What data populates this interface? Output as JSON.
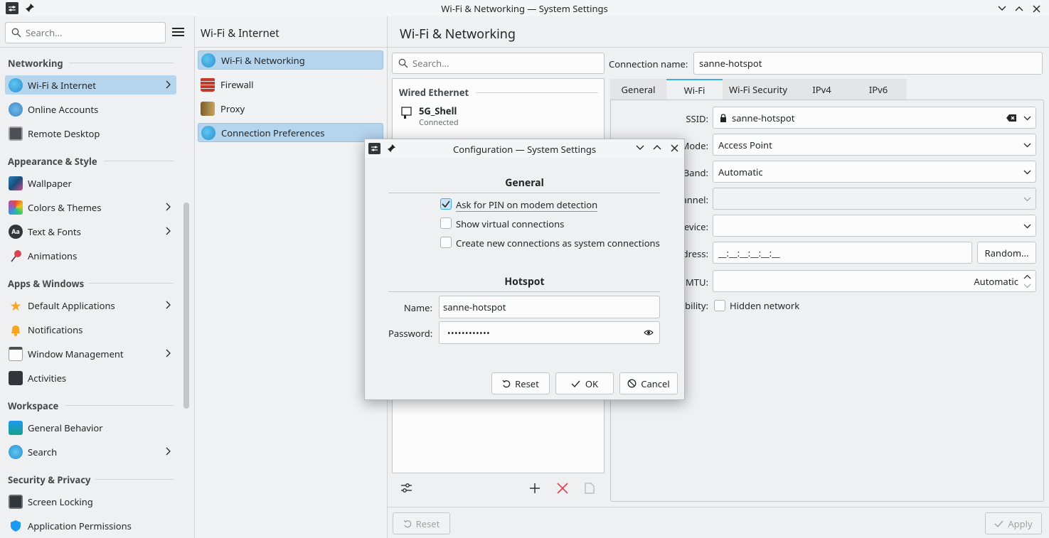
{
  "window": {
    "title": "Wi-Fi & Networking — System Settings"
  },
  "sidebar": {
    "search_placeholder": "Search...",
    "categories": [
      {
        "name": "Networking"
      },
      {
        "name": "Appearance & Style"
      },
      {
        "name": "Apps & Windows"
      },
      {
        "name": "Workspace"
      },
      {
        "name": "Security & Privacy"
      }
    ],
    "items": [
      {
        "label": "Wi-Fi & Internet"
      },
      {
        "label": "Online Accounts"
      },
      {
        "label": "Remote Desktop"
      },
      {
        "label": "Wallpaper"
      },
      {
        "label": "Colors & Themes"
      },
      {
        "label": "Text & Fonts"
      },
      {
        "label": "Animations"
      },
      {
        "label": "Default Applications"
      },
      {
        "label": "Notifications"
      },
      {
        "label": "Window Management"
      },
      {
        "label": "Activities"
      },
      {
        "label": "General Behavior"
      },
      {
        "label": "Search"
      },
      {
        "label": "Screen Locking"
      },
      {
        "label": "Application Permissions"
      }
    ]
  },
  "middle": {
    "header": "Wi-Fi & Internet",
    "items": [
      {
        "label": "Wi-Fi & Networking"
      },
      {
        "label": "Firewall"
      },
      {
        "label": "Proxy"
      },
      {
        "label": "Connection Preferences"
      }
    ]
  },
  "right": {
    "header": "Wi-Fi & Networking",
    "search_placeholder": "Search...",
    "list_section": "Wired Ethernet",
    "connection": {
      "name": "5G_Shell",
      "status": "Connected"
    },
    "connection_name_label": "Connection name:",
    "connection_name_value": "sanne-hotspot",
    "tabs": [
      "General",
      "Wi-Fi",
      "Wi-Fi Security",
      "IPv4",
      "IPv6"
    ],
    "fields": {
      "ssid_label": "SSID:",
      "ssid_value": "sanne-hotspot",
      "mode_label": "Mode:",
      "mode_value": "Access Point",
      "band_label": "Band:",
      "band_value": "Automatic",
      "channel_label": "annel:",
      "device_label": "evice:",
      "address_label": "dress:",
      "address_value": "__:__:__:__:__:__",
      "random_button": "Random...",
      "mtu_label": "MTU:",
      "mtu_value": "Automatic",
      "visibility_label": "bility:",
      "hidden_network": "Hidden network"
    },
    "reset_button": "Reset",
    "apply_button": "Apply"
  },
  "dialog": {
    "title": "Configuration — System Settings",
    "general_heading": "General",
    "options": [
      {
        "label": "Ask for PIN on modem detection",
        "checked": true
      },
      {
        "label": "Show virtual connections",
        "checked": false
      },
      {
        "label": "Create new connections as system connections",
        "checked": false
      }
    ],
    "hotspot_heading": "Hotspot",
    "name_label": "Name:",
    "name_value": "sanne-hotspot",
    "password_label": "Password:",
    "password_value": "••••••••••••",
    "reset_button": "Reset",
    "ok_button": "OK",
    "cancel_button": "Cancel"
  },
  "colors": {
    "accent": "#3daee9",
    "selection": "#b5d4ee",
    "delete": "#da4453"
  }
}
